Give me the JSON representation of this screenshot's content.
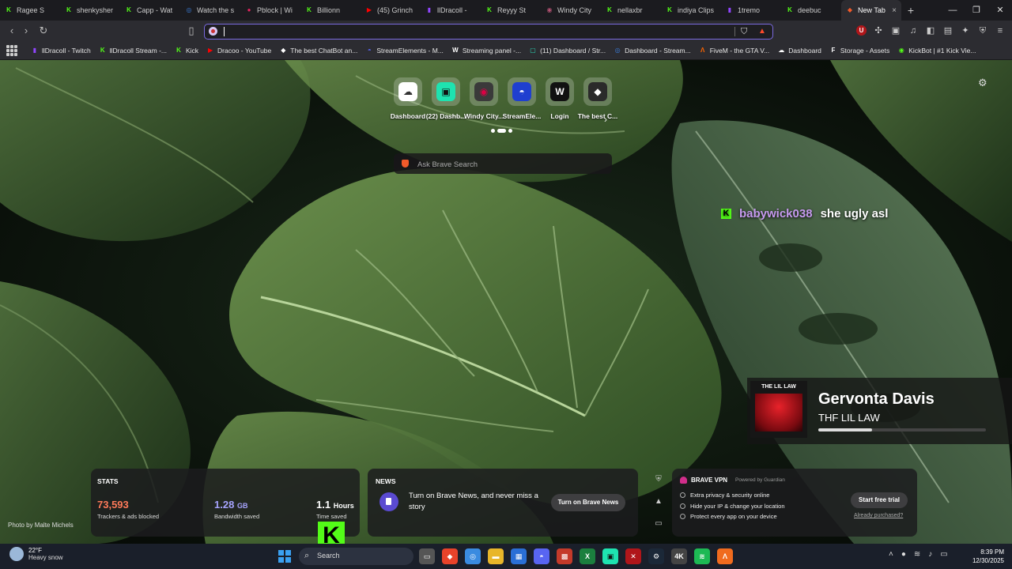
{
  "tabs": [
    {
      "title": "Ragee S",
      "fav": "K",
      "color": "#53fc18"
    },
    {
      "title": "shenkysher",
      "fav": "K",
      "color": "#53fc18"
    },
    {
      "title": "Capp - Wat",
      "fav": "K",
      "color": "#53fc18"
    },
    {
      "title": "Watch the s",
      "fav": "◎",
      "color": "#3a7bd5"
    },
    {
      "title": "Pblock | Wi",
      "fav": "●",
      "color": "#e0245e"
    },
    {
      "title": "Billionn",
      "fav": "K",
      "color": "#53fc18"
    },
    {
      "title": "(45) Grinch",
      "fav": "▶",
      "color": "#ff0000"
    },
    {
      "title": "llDracoll -",
      "fav": "▮",
      "color": "#9146ff"
    },
    {
      "title": "Reyyy St",
      "fav": "K",
      "color": "#53fc18"
    },
    {
      "title": "Windy City",
      "fav": "◉",
      "color": "#b05070"
    },
    {
      "title": "nellaxbr",
      "fav": "K",
      "color": "#53fc18"
    },
    {
      "title": "indiya Clips",
      "fav": "K",
      "color": "#53fc18"
    },
    {
      "title": "1tremo",
      "fav": "▮",
      "color": "#9146ff"
    },
    {
      "title": "deebuc",
      "fav": "K",
      "color": "#53fc18"
    }
  ],
  "active_tab": {
    "title": "New Tab",
    "close": "×"
  },
  "new_tab_button": "+",
  "window_controls": {
    "minimize": "—",
    "maximize": "❐",
    "close": "✕"
  },
  "omnibox": {
    "value": "",
    "placeholder": ""
  },
  "bookmarks": [
    {
      "label": "llDracoll - Twitch",
      "fav": "▮",
      "color": "#9146ff"
    },
    {
      "label": "llDracoll Stream -...",
      "fav": "K",
      "color": "#53fc18"
    },
    {
      "label": "Kick",
      "fav": "K",
      "color": "#53fc18"
    },
    {
      "label": "Dracoo - YouTube",
      "fav": "▶",
      "color": "#ff0000"
    },
    {
      "label": "The best ChatBot an...",
      "fav": "◆",
      "color": "#ffffff"
    },
    {
      "label": "StreamElements - M...",
      "fav": "◓",
      "color": "#5865f2"
    },
    {
      "label": "Streaming panel -...",
      "fav": "W",
      "color": "#ffffff"
    },
    {
      "label": "(11) Dashboard / Str...",
      "fav": "▢",
      "color": "#2bd9b6"
    },
    {
      "label": "Dashboard - Stream...",
      "fav": "◎",
      "color": "#3a7bd5"
    },
    {
      "label": "FiveM - the GTA V...",
      "fav": "Λ",
      "color": "#f60"
    },
    {
      "label": "Dashboard",
      "fav": "☁",
      "color": "#ffffff"
    },
    {
      "label": "Storage - Assets",
      "fav": "F",
      "color": "#ffffff"
    },
    {
      "label": "KickBot | #1 Kick Vie...",
      "fav": "◉",
      "color": "#53fc18"
    }
  ],
  "top_sites": [
    {
      "label": "Dashboard",
      "bg": "#ffffff",
      "fg": "#333",
      "glyph": "☁"
    },
    {
      "label": "(22) Dashb...",
      "bg": "#1ee3b0",
      "fg": "#111",
      "glyph": "▣"
    },
    {
      "label": "Windy City...",
      "bg": "#3a3a3a",
      "fg": "#d04",
      "glyph": "◉"
    },
    {
      "label": "StreamEle...",
      "bg": "#1f3fd0",
      "fg": "#fff",
      "glyph": "◓"
    },
    {
      "label": "Login",
      "bg": "#111",
      "fg": "#fff",
      "glyph": "W"
    },
    {
      "label": "The best C...",
      "bg": "#2a2a2a",
      "fg": "#fff",
      "glyph": "◆"
    }
  ],
  "search_box": {
    "placeholder": "Ask Brave Search"
  },
  "chat": {
    "user": "babywick038",
    "message": "she ugly asl"
  },
  "now_playing": {
    "song": "Gervonta Davis",
    "artist": "THF LIL LAW",
    "album_text": "THE LIL LAW",
    "progress": 0.32
  },
  "photo_credit": "Photo by Malte Michels",
  "stats": {
    "header": "STATS",
    "trackers_value": "73,593",
    "trackers_label": "Trackers & ads blocked",
    "bandwidth_value": "1.28",
    "bandwidth_unit": "GB",
    "bandwidth_label": "Bandwidth saved",
    "time_value": "1.1",
    "time_unit": "Hours",
    "time_label": "Time saved",
    "trackers_color": "#ff7a59",
    "bandwidth_color": "#a7a4ff"
  },
  "news": {
    "header": "NEWS",
    "text": "Turn on Brave News, and never miss a story",
    "button": "Turn on Brave News"
  },
  "vpn": {
    "title": "BRAVE VPN",
    "powered": "Powered by Guardian",
    "items": [
      "Extra privacy & security online",
      "Hide your IP & change your location",
      "Protect every app on your device"
    ],
    "trial": "Start free trial",
    "already": "Already purchased?"
  },
  "taskbar": {
    "temp": "22°F",
    "weather": "Heavy snow",
    "search": "Search",
    "time": "8:39 PM",
    "date": "12/30/2025"
  }
}
